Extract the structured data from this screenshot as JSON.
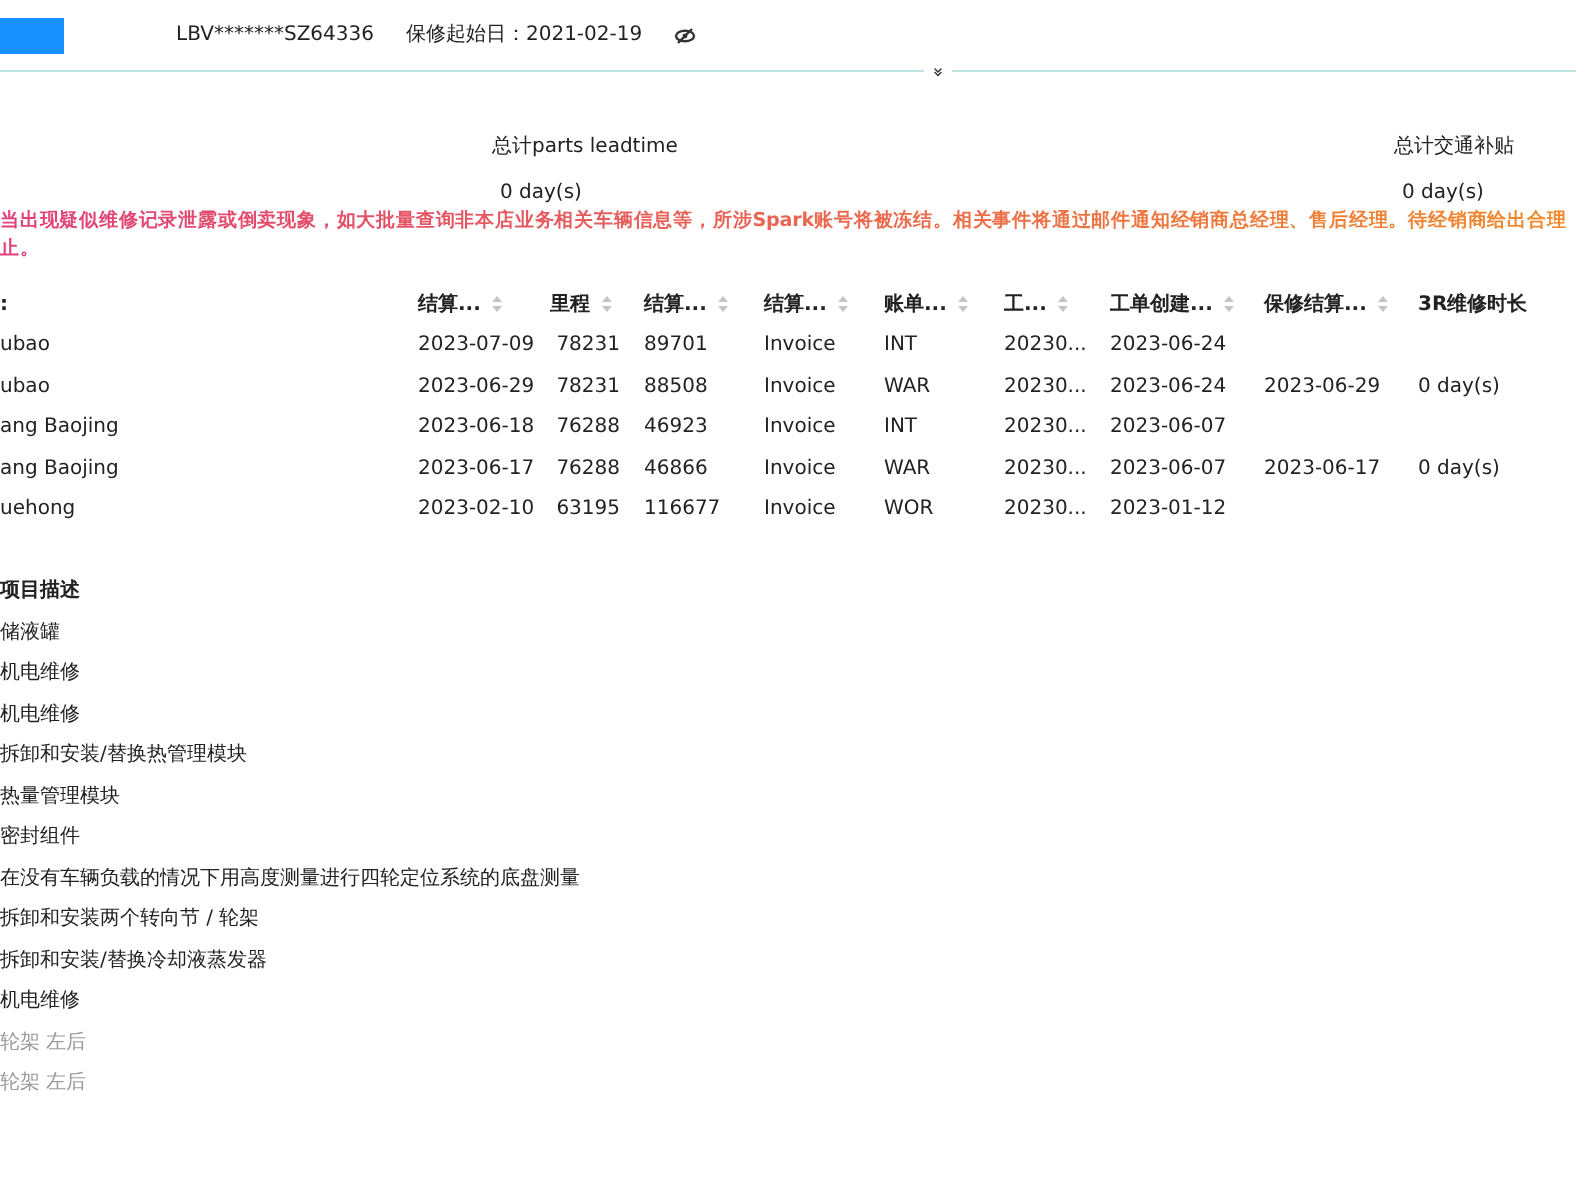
{
  "header": {
    "vin": "LBV*******SZ64336",
    "warranty_start": "保修起始日：2021-02-19",
    "vin_hidden": true
  },
  "summary": [
    {
      "label": "总计parts leadtime",
      "value": "0 day(s)"
    },
    {
      "label": "总计交通补贴",
      "value": "0 day(s)"
    }
  ],
  "warning": {
    "lines": [
      "当出现疑似维修记录泄露或倒卖现象，如大批量查询非本店业务相关车辆信息等，所涉Spark账号将被冻结。相关事件将通过邮件通知经销商总经理、售后经理。待经销商给出合理",
      "止。"
    ]
  },
  "table": {
    "columns": [
      {
        "label": ":",
        "sortable": false
      },
      {
        "label": "结算...",
        "sortable": true
      },
      {
        "label": "里程",
        "sortable": true
      },
      {
        "label": "结算...",
        "sortable": true
      },
      {
        "label": "结算...",
        "sortable": true
      },
      {
        "label": "账单...",
        "sortable": true
      },
      {
        "label": "工...",
        "sortable": true
      },
      {
        "label": "工单创建...",
        "sortable": true
      },
      {
        "label": "保修结算...",
        "sortable": true
      },
      {
        "label": "3R维修时长",
        "sortable": false
      }
    ],
    "rows": [
      [
        "ubao",
        "2023-07-09",
        "78231",
        "89701",
        "Invoice",
        "INT",
        "20230...",
        "2023-06-24",
        "",
        ""
      ],
      [
        "ubao",
        "2023-06-29",
        "78231",
        "88508",
        "Invoice",
        "WAR",
        "20230...",
        "2023-06-24",
        "2023-06-29",
        "0 day(s)"
      ],
      [
        "ang Baojing",
        "2023-06-18",
        "76288",
        "46923",
        "Invoice",
        "INT",
        "20230...",
        "2023-06-07",
        "",
        ""
      ],
      [
        "ang Baojing",
        "2023-06-17",
        "76288",
        "46866",
        "Invoice",
        "WAR",
        "20230...",
        "2023-06-07",
        "2023-06-17",
        "0 day(s)"
      ],
      [
        "uehong",
        "2023-02-10",
        "63195",
        "116677",
        "Invoice",
        "WOR",
        "20230...",
        "2023-01-12",
        "",
        ""
      ]
    ]
  },
  "items": {
    "heading": "项目描述",
    "rows": [
      {
        "text": "储液罐",
        "faded": false
      },
      {
        "text": "机电维修",
        "faded": false
      },
      {
        "text": "机电维修",
        "faded": false
      },
      {
        "text": "拆卸和安装/替换热管理模块",
        "faded": false
      },
      {
        "text": "热量管理模块",
        "faded": false
      },
      {
        "text": "密封组件",
        "faded": false
      },
      {
        "text": "在没有车辆负载的情况下用高度测量进行四轮定位系统的底盘测量",
        "faded": false
      },
      {
        "text": "拆卸和安装两个转向节 / 轮架",
        "faded": false
      },
      {
        "text": "拆卸和安装/替换冷却液蒸发器",
        "faded": false
      },
      {
        "text": "机电维修",
        "faded": false
      },
      {
        "text": "轮架 左后",
        "faded": true
      },
      {
        "text": "轮架 左后",
        "faded": true
      }
    ]
  }
}
